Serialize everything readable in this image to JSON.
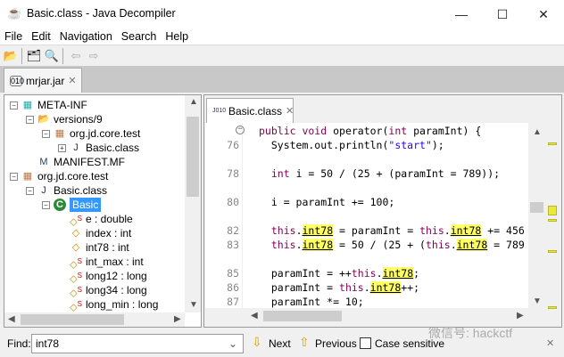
{
  "window": {
    "title": "Basic.class - Java Decompiler",
    "minimize": "—",
    "maximize": "☐",
    "close": "✕"
  },
  "menu": [
    "File",
    "Edit",
    "Navigation",
    "Search",
    "Help"
  ],
  "toolbar": {
    "open": "📂",
    "open_type": "🗂",
    "search": "🔍",
    "back": "⇦",
    "forward": "⇨"
  },
  "file_tab": {
    "label": "mrjar.jar"
  },
  "tree": [
    {
      "label": "META-INF",
      "icon": "package-folder-icon",
      "depth": 0,
      "expander": "−"
    },
    {
      "label": "versions/9",
      "icon": "folder-icon",
      "depth": 1,
      "expander": "−"
    },
    {
      "label": "org.jd.core.test",
      "icon": "package-icon",
      "depth": 2,
      "expander": "−"
    },
    {
      "label": "Basic.class",
      "icon": "class-file-icon",
      "depth": 3,
      "expander": "+"
    },
    {
      "label": "MANIFEST.MF",
      "icon": "manifest-icon",
      "depth": 1,
      "expander": ""
    },
    {
      "label": "org.jd.core.test",
      "icon": "package-icon",
      "depth": 0,
      "expander": "−"
    },
    {
      "label": "Basic.class",
      "icon": "class-file-icon",
      "depth": 1,
      "expander": "−"
    },
    {
      "label": "Basic",
      "icon": "class-icon",
      "depth": 2,
      "expander": "−",
      "selected": true
    },
    {
      "label": "e : double",
      "icon": "static-field-icon",
      "depth": 3
    },
    {
      "label": "index : int",
      "icon": "field-icon",
      "depth": 3
    },
    {
      "label": "int78 : int",
      "icon": "field-icon",
      "depth": 3
    },
    {
      "label": "int_max : int",
      "icon": "static-field-icon",
      "depth": 3
    },
    {
      "label": "long12 : long",
      "icon": "static-field-icon",
      "depth": 3
    },
    {
      "label": "long34 : long",
      "icon": "static-field-icon",
      "depth": 3
    },
    {
      "label": "long_min : long",
      "icon": "static-field-icon",
      "depth": 3
    }
  ],
  "editor_tab": {
    "label": "Basic.class"
  },
  "code": [
    {
      "n": "",
      "html": "<span class='k'>public void</span> operator(<span class='k'>int</span> paramInt) {"
    },
    {
      "n": "76",
      "html": "  System.out.println(<span class='s'>\"start\"</span>);"
    },
    {
      "n": "",
      "html": ""
    },
    {
      "n": "78",
      "html": "  <span class='k'>int</span> i = 50 / (25 + (paramInt = 789));"
    },
    {
      "n": "",
      "html": ""
    },
    {
      "n": "80",
      "html": "  i = paramInt += 100;"
    },
    {
      "n": "",
      "html": ""
    },
    {
      "n": "82",
      "html": "  <span class='k'>this</span>.<span class='h'>int78</span> = paramInt = <span class='k'>this</span>.<span class='h'>int78</span> += 456"
    },
    {
      "n": "83",
      "html": "  <span class='k'>this</span>.<span class='h'>int78</span> = 50 / (25 + (<span class='k'>this</span>.<span class='h'>int78</span> = 789"
    },
    {
      "n": "",
      "html": ""
    },
    {
      "n": "85",
      "html": "  paramInt = ++<span class='k'>this</span>.<span class='h'>int78</span>;"
    },
    {
      "n": "86",
      "html": "  paramInt = <span class='k'>this</span>.<span class='h'>int78</span>++;"
    },
    {
      "n": "87",
      "html": "  paramInt *= 10;"
    }
  ],
  "find": {
    "label": "Find:",
    "value": "int78",
    "next": "Next",
    "previous": "Previous",
    "case_sensitive": "Case sensitive",
    "case_checked": false
  },
  "watermark": "微信号: hackctf",
  "colors": {
    "keyword": "#7f0055",
    "string": "#2a00ff",
    "highlight": "#ffff66",
    "selection": "#3399ff"
  }
}
